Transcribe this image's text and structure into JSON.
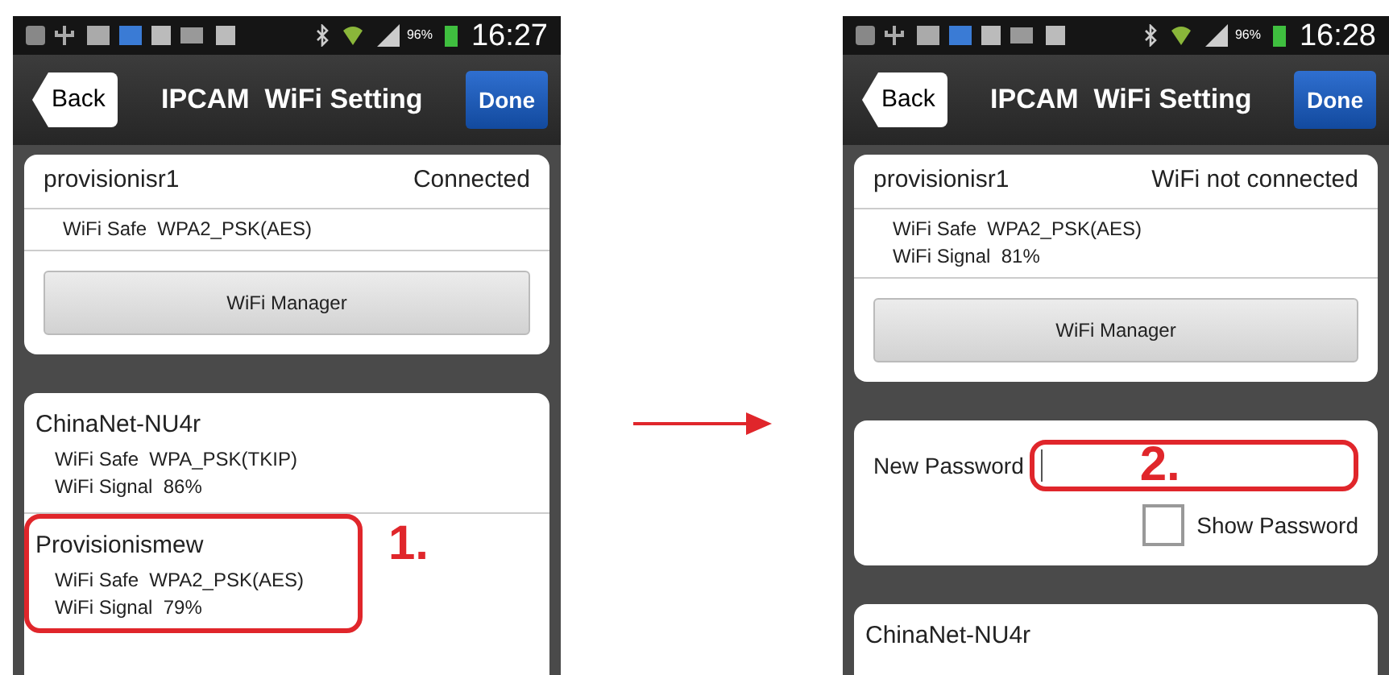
{
  "phones": [
    {
      "status_bar": {
        "battery_percent": "96%",
        "time": "16:27"
      },
      "nav_bar": {
        "back": "Back",
        "title": "IPCAM  WiFi Setting",
        "done": "Done"
      },
      "sections": [
        {
          "kind": "current",
          "ssid": "provisionisr1",
          "status": "Connected",
          "details": [
            "WiFi Safe  WPA2_PSK(AES)"
          ],
          "button": "WiFi Manager"
        },
        {
          "kind": "networks",
          "networks": [
            {
              "ssid": "ChinaNet-NU4r",
              "details": [
                "WiFi Safe  WPA_PSK(TKIP)",
                "WiFi Signal  86%"
              ],
              "highlighted": false
            },
            {
              "ssid": "Provisionismew",
              "details": [
                "WiFi Safe  WPA2_PSK(AES)",
                "WiFi Signal  79%"
              ],
              "highlighted": true,
              "callout": "1."
            }
          ]
        }
      ]
    },
    {
      "status_bar": {
        "battery_percent": "96%",
        "time": "16:28"
      },
      "nav_bar": {
        "back": "Back",
        "title": "IPCAM  WiFi Setting",
        "done": "Done"
      },
      "sections": [
        {
          "kind": "current",
          "ssid": "provisionisr1",
          "status": "WiFi not connected",
          "details": [
            "WiFi Safe  WPA2_PSK(AES)",
            "WiFi Signal  81%"
          ],
          "button": "WiFi Manager"
        },
        {
          "kind": "password",
          "label": "New Password",
          "highlighted": true,
          "callout": "2.",
          "show_password": {
            "label": "Show Password",
            "checked": false
          }
        },
        {
          "kind": "networks",
          "networks": [
            {
              "ssid": "ChinaNet-NU4r",
              "highlighted": false
            }
          ]
        }
      ]
    }
  ]
}
